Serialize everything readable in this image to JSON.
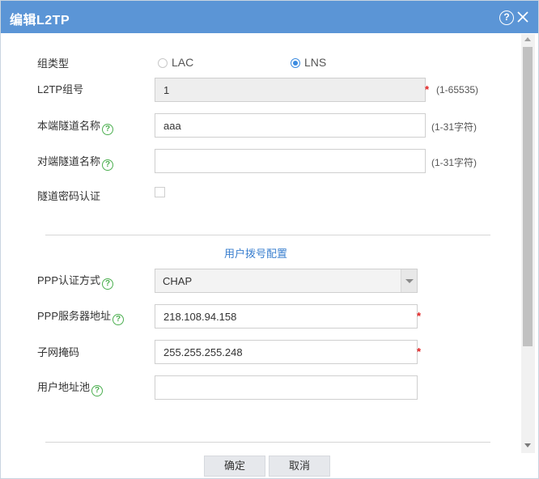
{
  "dialog": {
    "title": "编辑L2TP",
    "help_glyph": "?",
    "accent_color": "#5b95d6"
  },
  "form": {
    "group_type": {
      "label": "组类型",
      "options": [
        "LAC",
        "LNS"
      ],
      "selected": "LNS"
    },
    "group_id": {
      "label": "L2TP组号",
      "value": "1",
      "hint": "(1-65535)"
    },
    "local_tunnel": {
      "label": "本端隧道名称",
      "value": "aaa",
      "hint": "(1-31字符)"
    },
    "remote_tunnel": {
      "label": "对端隧道名称",
      "value": "",
      "hint": "(1-31字符)"
    },
    "tunnel_auth": {
      "label": "隧道密码认证",
      "checked": false
    },
    "required_mark": "*",
    "help_glyph": "?"
  },
  "section": {
    "title": "用户拨号配置",
    "ppp_auth": {
      "label": "PPP认证方式",
      "value": "CHAP"
    },
    "ppp_server": {
      "label": "PPP服务器地址",
      "value": "218.108.94.158"
    },
    "subnet_mask": {
      "label": "子网掩码",
      "value": "255.255.255.248"
    },
    "user_pool": {
      "label": "用户地址池",
      "value": ""
    }
  },
  "buttons": {
    "ok": "确定",
    "cancel": "取消"
  }
}
